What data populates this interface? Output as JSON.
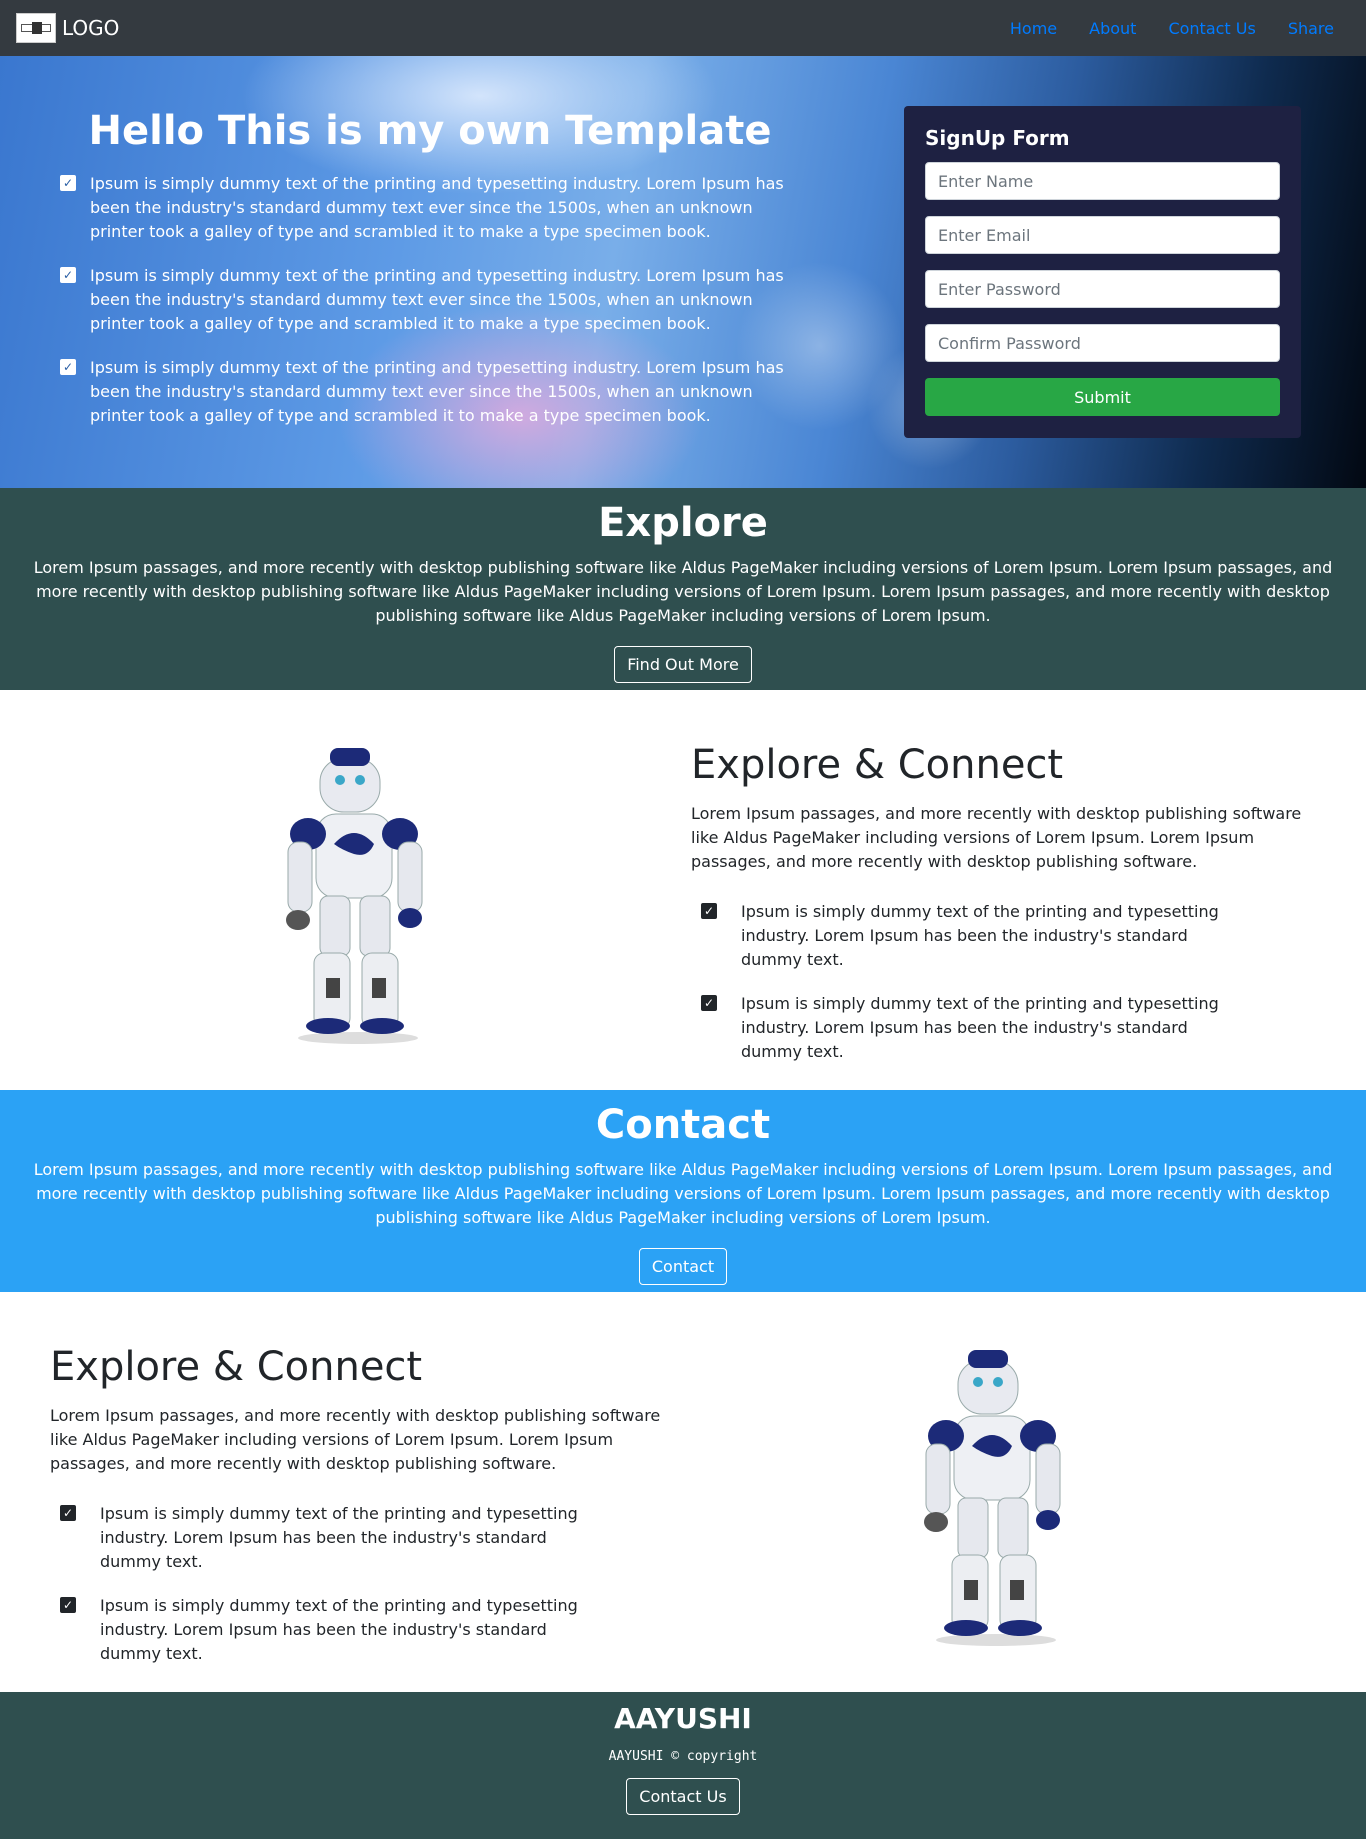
{
  "navbar": {
    "brand_text": "LOGO",
    "links": [
      "Home",
      "About",
      "Contact Us",
      "Share"
    ]
  },
  "hero": {
    "title": "Hello This is my own Template",
    "items": [
      "Ipsum is simply dummy text of the printing and typesetting industry. Lorem Ipsum has been the industry's standard dummy text ever since the 1500s, when an unknown printer took a galley of type and scrambled it to make a type specimen book.",
      "Ipsum is simply dummy text of the printing and typesetting industry. Lorem Ipsum has been the industry's standard dummy text ever since the 1500s, when an unknown printer took a galley of type and scrambled it to make a type specimen book.",
      "Ipsum is simply dummy text of the printing and typesetting industry. Lorem Ipsum has been the industry's standard dummy text ever since the 1500s, when an unknown printer took a galley of type and scrambled it to make a type specimen book."
    ]
  },
  "signup": {
    "title": "SignUp Form",
    "name_placeholder": "Enter Name",
    "email_placeholder": "Enter Email",
    "password_placeholder": "Enter Password",
    "confirm_placeholder": "Confirm Password",
    "submit_label": "Submit"
  },
  "explore": {
    "title": "Explore",
    "text": "Lorem Ipsum passages, and more recently with desktop publishing software like Aldus PageMaker including versions of Lorem Ipsum. Lorem Ipsum passages, and more recently with desktop publishing software like Aldus PageMaker including versions of Lorem Ipsum. Lorem Ipsum passages, and more recently with desktop publishing software like Aldus PageMaker including versions of Lorem Ipsum.",
    "button": "Find Out More"
  },
  "feature1": {
    "title": "Explore & Connect",
    "lead": "Lorem Ipsum passages, and more recently with desktop publishing software like Aldus PageMaker including versions of Lorem Ipsum. Lorem Ipsum passages, and more recently with desktop publishing software.",
    "items": [
      "Ipsum is simply dummy text of the printing and typesetting industry. Lorem Ipsum has been the industry's standard dummy text.",
      "Ipsum is simply dummy text of the printing and typesetting industry. Lorem Ipsum has been the industry's standard dummy text."
    ]
  },
  "contact": {
    "title": "Contact",
    "text": "Lorem Ipsum passages, and more recently with desktop publishing software like Aldus PageMaker including versions of Lorem Ipsum. Lorem Ipsum passages, and more recently with desktop publishing software like Aldus PageMaker including versions of Lorem Ipsum. Lorem Ipsum passages, and more recently with desktop publishing software like Aldus PageMaker including versions of Lorem Ipsum.",
    "button": "Contact"
  },
  "feature2": {
    "title": "Explore & Connect",
    "lead": "Lorem Ipsum passages, and more recently with desktop publishing software like Aldus PageMaker including versions of Lorem Ipsum. Lorem Ipsum passages, and more recently with desktop publishing software.",
    "items": [
      "Ipsum is simply dummy text of the printing and typesetting industry. Lorem Ipsum has been the industry's standard dummy text.",
      "Ipsum is simply dummy text of the printing and typesetting industry. Lorem Ipsum has been the industry's standard dummy text."
    ]
  },
  "footer": {
    "title": "AAYUSHI",
    "copyright": "AAYUSHI © copyright",
    "button": "Contact Us"
  },
  "colors": {
    "navbar_bg": "#343a40",
    "link": "#007bff",
    "signup_bg": "#1e2142",
    "submit": "#28a745",
    "dark_band": "#2f4f4f",
    "blue_band": "#2ba2f5"
  },
  "icons": [
    "check-square-icon",
    "robot-image",
    "logo-image"
  ]
}
